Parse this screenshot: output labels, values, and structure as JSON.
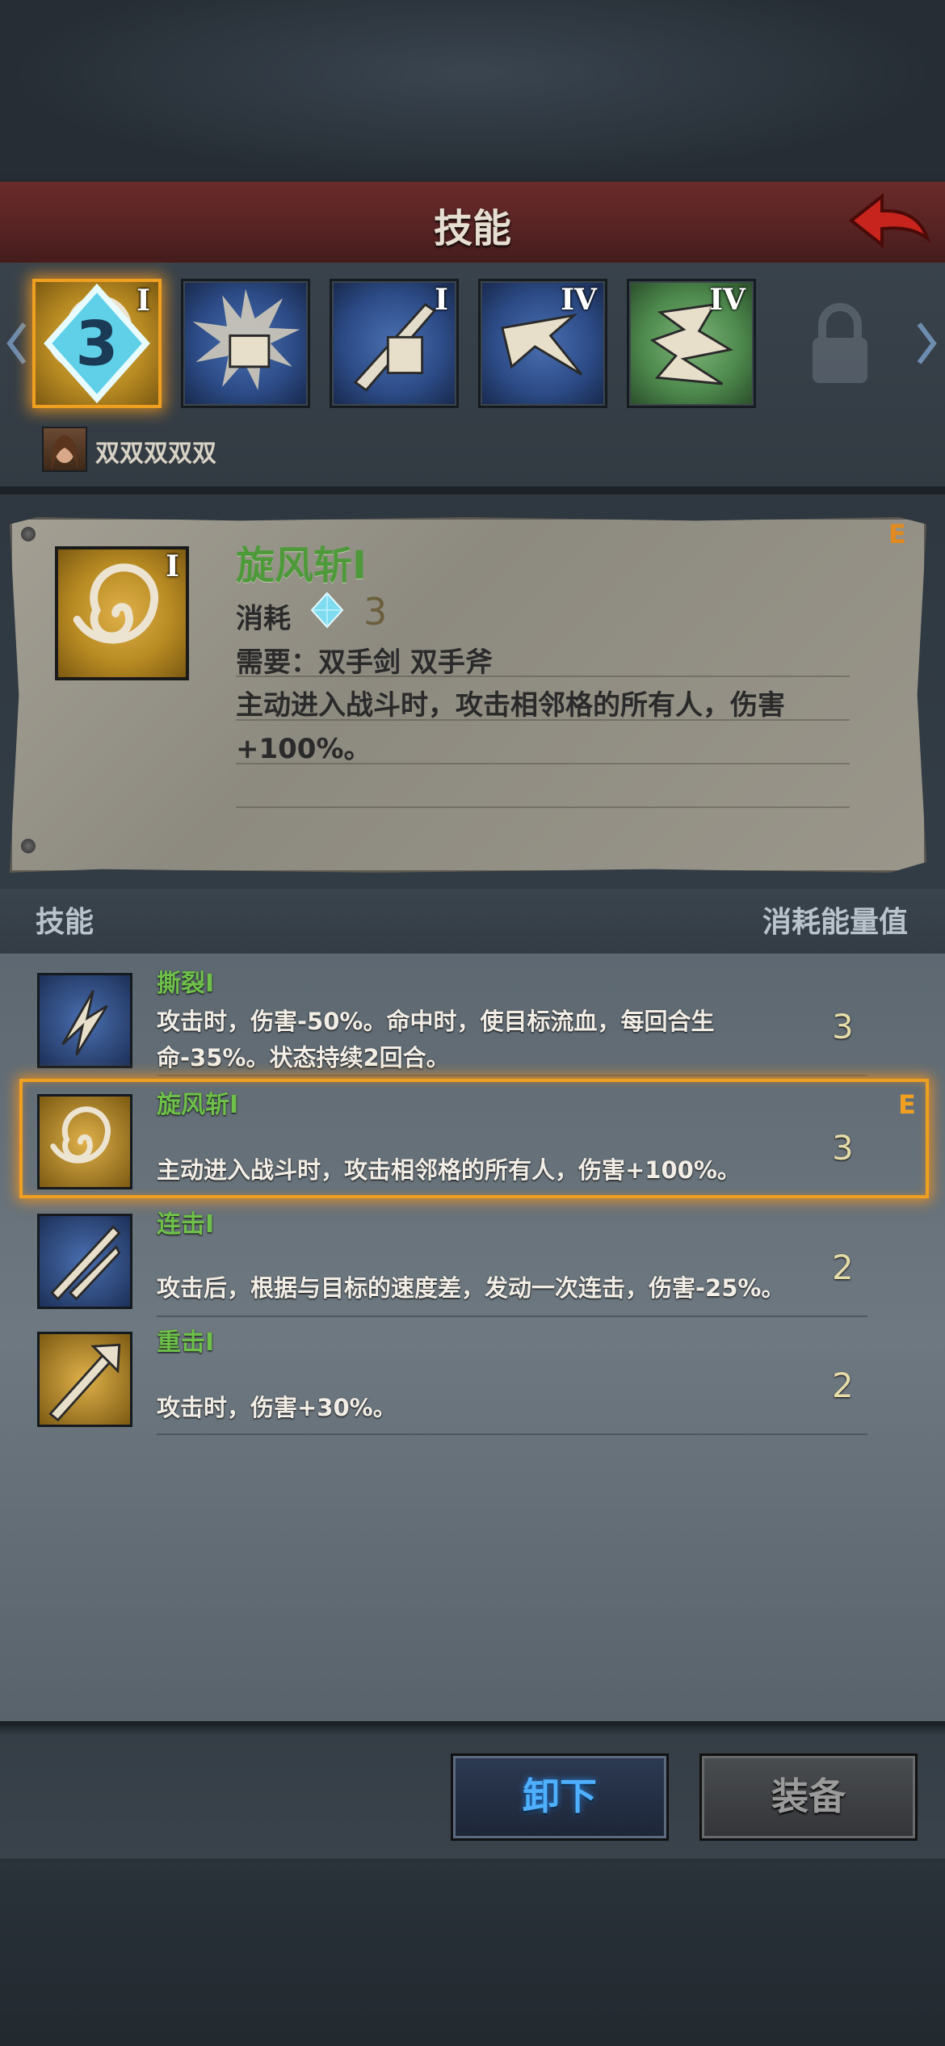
{
  "header": {
    "title": "技能"
  },
  "skill_strip": {
    "slots": [
      {
        "rank": "I",
        "cost": "3",
        "theme": "gold"
      },
      {
        "rank": "",
        "theme": "blue"
      },
      {
        "rank": "I",
        "theme": "blue"
      },
      {
        "rank": "IV",
        "theme": "blue"
      },
      {
        "rank": "IV",
        "theme": "green"
      }
    ],
    "character_name": "双双双双双"
  },
  "detail": {
    "rank": "I",
    "grade": "E",
    "name": "旋风斩I",
    "cost_label": "消耗",
    "cost_value": "3",
    "requirement": "需要：双手剑  双手斧",
    "description": "主动进入战斗时，攻击相邻格的所有人，伤害+100%。"
  },
  "list": {
    "header_left": "技能",
    "header_right": "消耗能量值",
    "selected_grade": "E",
    "rows": [
      {
        "name": "撕裂I",
        "desc": "攻击时，伤害-50%。命中时，使目标流血，每回合生命-35%。状态持续2回合。",
        "cost": "3"
      },
      {
        "name": "旋风斩I",
        "desc": "主动进入战斗时，攻击相邻格的所有人，伤害+100%。",
        "cost": "3"
      },
      {
        "name": "连击I",
        "desc": "攻击后，根据与目标的速度差，发动一次连击，伤害-25%。",
        "cost": "2"
      },
      {
        "name": "重击I",
        "desc": "攻击时，伤害+30%。",
        "cost": "2"
      }
    ]
  },
  "buttons": {
    "unequip": "卸下",
    "equip": "装备"
  }
}
